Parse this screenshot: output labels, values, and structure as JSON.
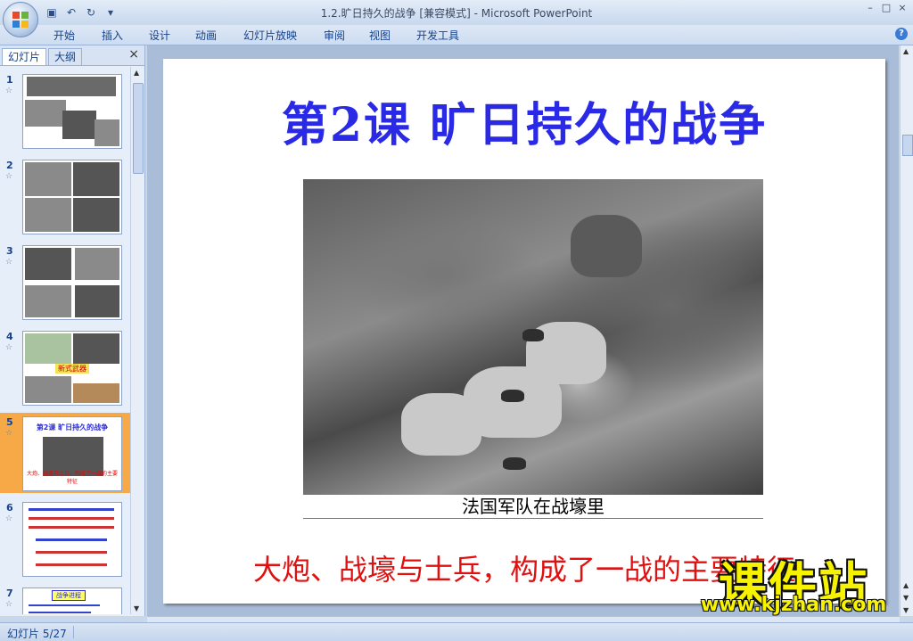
{
  "window": {
    "title": "1.2.旷日持久的战争 [兼容模式] - Microsoft PowerPoint",
    "controls": [
      "–",
      "□",
      "×"
    ]
  },
  "qat": {
    "icons": [
      "save-icon",
      "undo-icon",
      "redo-icon",
      "customize-icon"
    ]
  },
  "ribbon": {
    "tabs": [
      "开始",
      "插入",
      "设计",
      "动画",
      "幻灯片放映",
      "审阅",
      "视图",
      "开发工具"
    ],
    "help": "?"
  },
  "panel": {
    "tabs": [
      "幻灯片",
      "大纲"
    ],
    "close": "×",
    "thumbnails": [
      {
        "num": "1"
      },
      {
        "num": "2"
      },
      {
        "num": "3"
      },
      {
        "num": "4"
      },
      {
        "num": "5",
        "title": "第2课 旷日持久的战争",
        "caption": "大炮、战壕与士兵，构成了一战的主要特征"
      },
      {
        "num": "6"
      },
      {
        "num": "7",
        "label": "战争进程"
      }
    ],
    "thumb4_label": "新式武器",
    "star": "☆"
  },
  "slide": {
    "title": "第2课  旷日持久的战争",
    "photo_caption": "法国军队在战壕里",
    "text": "大炮、战壕与士兵，构成了一战的主要特征"
  },
  "watermark": {
    "big": "课件站",
    "small": "www.kjzhan.com"
  },
  "status": {
    "slide_count": "幻灯片 5/27"
  }
}
